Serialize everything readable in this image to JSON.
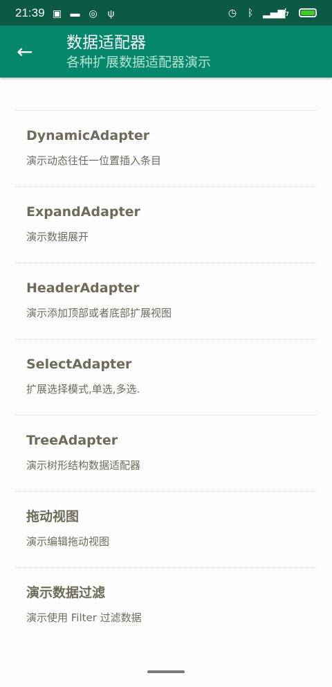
{
  "status": {
    "time": "21:39"
  },
  "appbar": {
    "title": "数据适配器",
    "subtitle": "各种扩展数据适配器演示"
  },
  "items": [
    {
      "title": "DynamicAdapter",
      "desc": "演示动态往任一位置插入条目"
    },
    {
      "title": "ExpandAdapter",
      "desc": "演示数据展开"
    },
    {
      "title": "HeaderAdapter",
      "desc": "演示添加顶部或者底部扩展视图"
    },
    {
      "title": "SelectAdapter",
      "desc": "扩展选择模式,单选,多选."
    },
    {
      "title": "TreeAdapter",
      "desc": "演示树形结构数据适配器"
    },
    {
      "title": "拖动视图",
      "desc": "演示编辑拖动视图"
    },
    {
      "title": "演示数据过滤",
      "desc": "演示使用 Filter 过滤数据"
    }
  ]
}
